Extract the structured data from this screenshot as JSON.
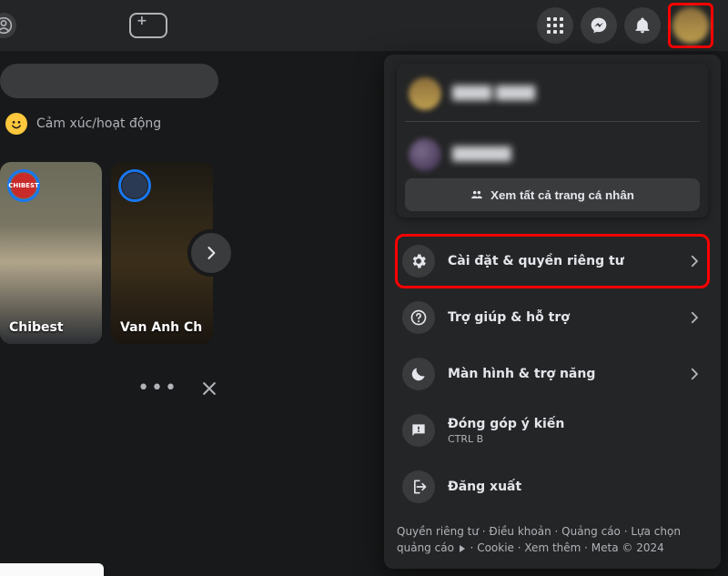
{
  "topnav": {
    "menu_icon": "grid-icon",
    "messenger_icon": "messenger-icon",
    "notifications_icon": "bell-icon",
    "account_icon": "avatar-icon"
  },
  "left": {
    "activity_label": "Cảm xúc/hoạt động",
    "stories": [
      {
        "label": "Chibest"
      },
      {
        "label": "Van Anh Ch"
      }
    ]
  },
  "panel": {
    "see_all_label": "Xem tất cả trang cá nhân",
    "profiles": [
      {
        "name": "████ ████"
      },
      {
        "name": "██████"
      }
    ],
    "items": [
      {
        "icon": "gear-icon",
        "label": "Cài đặt & quyền riêng tư",
        "has_chevron": true,
        "highlight": true
      },
      {
        "icon": "help-icon",
        "label": "Trợ giúp & hỗ trợ",
        "has_chevron": true,
        "highlight": false
      },
      {
        "icon": "moon-icon",
        "label": "Màn hình & trợ năng",
        "has_chevron": true,
        "highlight": false
      },
      {
        "icon": "feedback-icon",
        "label": "Đóng góp ý kiến",
        "sub": "CTRL B",
        "has_chevron": false,
        "highlight": false
      },
      {
        "icon": "logout-icon",
        "label": "Đăng xuất",
        "has_chevron": false,
        "highlight": false
      }
    ],
    "footer": {
      "privacy": "Quyền riêng tư",
      "terms": "Điều khoản",
      "ads": "Quảng cáo",
      "ad_choices": "Lựa chọn quảng cáo",
      "cookie": "Cookie",
      "more": "Xem thêm",
      "meta": "Meta © 2024"
    }
  }
}
